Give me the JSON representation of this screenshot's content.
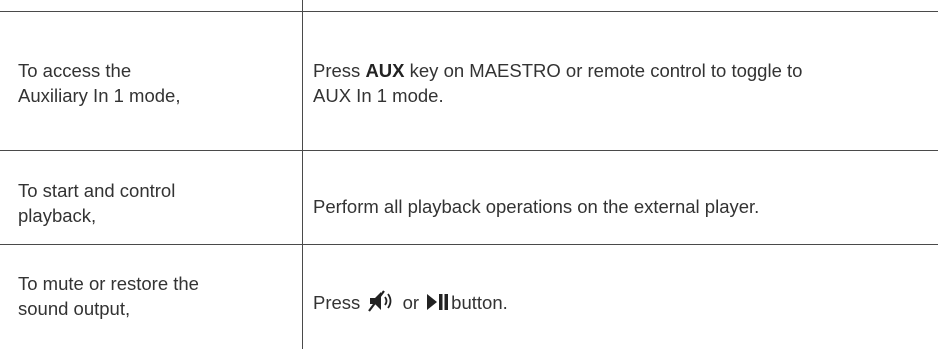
{
  "rows": [
    {
      "action": "To access the Auxiliary In 1 mode,",
      "action_line1": "To access the",
      "action_line2": "Auxiliary In 1 mode,",
      "instruction_prefix": "Press ",
      "instruction_key": "AUX",
      "instruction_line1_rest": " key on MAESTRO or remote control to toggle to",
      "instruction_line2": "AUX In 1 mode."
    },
    {
      "action_line1": "To start and control",
      "action_line2": "playback,",
      "instruction": "Perform all playback operations on the external player."
    },
    {
      "action_line1": "To mute or restore the",
      "action_line2": "sound output,",
      "instruction_prefix": "Press",
      "instruction_middle": "or",
      "instruction_suffix": "button.",
      "icons": [
        "mute-icon",
        "play-pause-icon"
      ]
    }
  ],
  "colors": {
    "text": "#333333",
    "rule": "#4a4a4a",
    "background": "#ffffff"
  }
}
